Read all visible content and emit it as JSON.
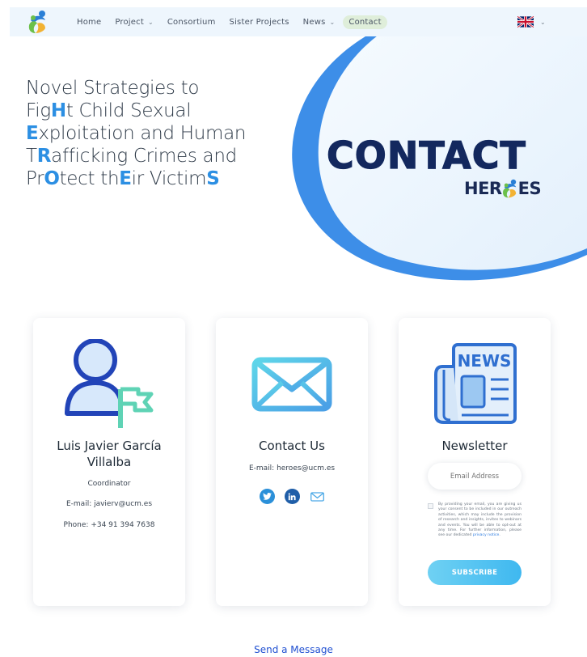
{
  "nav": {
    "items": [
      {
        "label": "Home",
        "has_dropdown": false
      },
      {
        "label": "Project",
        "has_dropdown": true
      },
      {
        "label": "Consortium",
        "has_dropdown": false
      },
      {
        "label": "Sister Projects",
        "has_dropdown": false
      },
      {
        "label": "News",
        "has_dropdown": true
      },
      {
        "label": "Contact",
        "has_dropdown": false,
        "active": true
      }
    ],
    "language_icon": "uk-flag-icon"
  },
  "hero": {
    "tagline_lines": [
      [
        {
          "t": "Novel Strategies to"
        }
      ],
      [
        {
          "t": "Fig"
        },
        {
          "t": "H",
          "hl": true
        },
        {
          "t": "t Child Sexual"
        }
      ],
      [
        {
          "t": "E",
          "hl": true
        },
        {
          "t": "xploitation and Human"
        }
      ],
      [
        {
          "t": "T"
        },
        {
          "t": "R",
          "hl": true
        },
        {
          "t": "afficking Crimes and"
        }
      ],
      [
        {
          "t": "Pr"
        },
        {
          "t": "O",
          "hl": true
        },
        {
          "t": "tect th"
        },
        {
          "t": "E",
          "hl": true
        },
        {
          "t": "ir Victim"
        },
        {
          "t": "S",
          "hl": true
        }
      ]
    ],
    "title": "CONTACT",
    "logo_left": "HER",
    "logo_right": "ES"
  },
  "cards": {
    "coordinator": {
      "name": "Luis Javier García Villalba",
      "role": "Coordinator",
      "email": "E-mail: javierv@ucm.es",
      "phone": "Phone: +34 91 394 7638",
      "icon": "person-flag-icon"
    },
    "contact": {
      "title": "Contact Us",
      "email": "E-mail: heroes@ucm.es",
      "icon": "envelope-icon",
      "socials": [
        "twitter-icon",
        "linkedin-icon",
        "mail-icon"
      ]
    },
    "newsletter": {
      "title": "Newsletter",
      "icon": "newspaper-icon",
      "icon_text": "NEWS",
      "email_placeholder": "Email Address",
      "consent_text": "By providing your email, you are giving us your consent to be included in our outreach activities, which may include the provision of research and insights, invites to webinars and events. You will be able to opt-out at any time. For further information, please see our dedicated ",
      "consent_link": "privacy notice",
      "consent_end": ".",
      "subscribe_label": "SUBSCRIBE"
    }
  },
  "footer": {
    "send_message": "Send a Message"
  },
  "colors": {
    "accent": "#2c8fe3",
    "title": "#13285e",
    "link": "#1f4fd1"
  }
}
